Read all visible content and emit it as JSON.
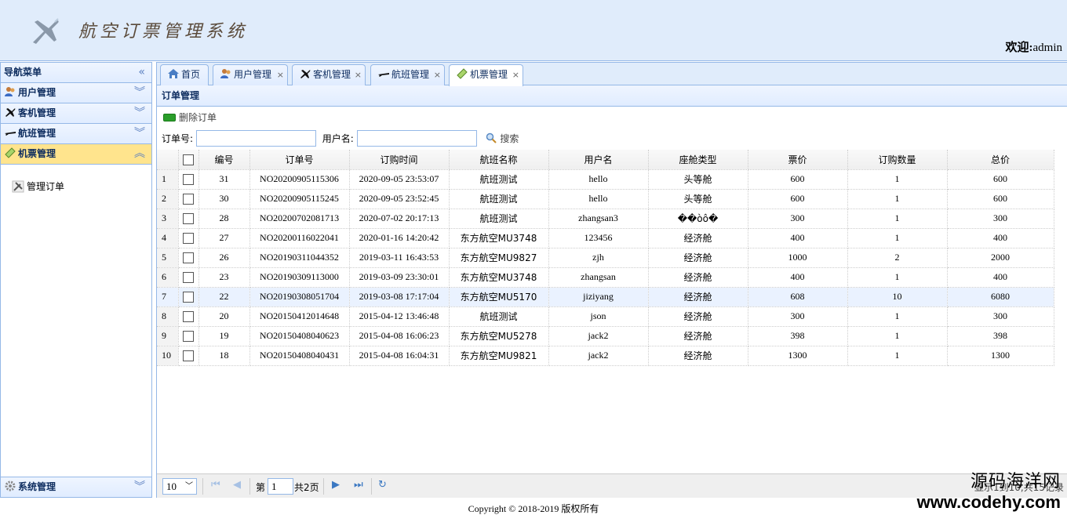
{
  "header": {
    "title": "航空订票管理系统",
    "welcome_label": "欢迎:",
    "username": "admin"
  },
  "nav": {
    "title": "导航菜单",
    "sections": [
      {
        "label": "用户管理",
        "icon": "users-icon"
      },
      {
        "label": "客机管理",
        "icon": "airplane-icon"
      },
      {
        "label": "航班管理",
        "icon": "flight-icon"
      },
      {
        "label": "机票管理",
        "icon": "ticket-icon"
      }
    ],
    "active_item": "管理订单",
    "bottom_section": "系统管理"
  },
  "tabs": [
    {
      "label": "首页",
      "icon": "home-icon",
      "closable": false
    },
    {
      "label": "用户管理",
      "icon": "users-icon",
      "closable": true
    },
    {
      "label": "客机管理",
      "icon": "airplane-icon",
      "closable": true
    },
    {
      "label": "航班管理",
      "icon": "flight-icon",
      "closable": true
    },
    {
      "label": "机票管理",
      "icon": "ticket-icon",
      "closable": true
    }
  ],
  "grid": {
    "title": "订单管理",
    "delete_label": "删除订单",
    "order_no_label": "订单号:",
    "username_label": "用户名:",
    "search_label": "搜索",
    "columns": [
      "编号",
      "订单号",
      "订购时间",
      "航班名称",
      "用户名",
      "座舱类型",
      "票价",
      "订购数量",
      "总价"
    ],
    "rows": [
      [
        "31",
        "NO20200905115306",
        "2020-09-05 23:53:07",
        "航班测试",
        "hello",
        "头等舱",
        "600",
        "1",
        "600"
      ],
      [
        "30",
        "NO20200905115245",
        "2020-09-05 23:52:45",
        "航班测试",
        "hello",
        "头等舱",
        "600",
        "1",
        "600"
      ],
      [
        "28",
        "NO20200702081713",
        "2020-07-02 20:17:13",
        "航班测试",
        "zhangsan3",
        "��òô�",
        "300",
        "1",
        "300"
      ],
      [
        "27",
        "NO20200116022041",
        "2020-01-16 14:20:42",
        "东方航空MU3748",
        "123456",
        "经济舱",
        "400",
        "1",
        "400"
      ],
      [
        "26",
        "NO20190311044352",
        "2019-03-11 16:43:53",
        "东方航空MU9827",
        "zjh",
        "经济舱",
        "1000",
        "2",
        "2000"
      ],
      [
        "23",
        "NO20190309113000",
        "2019-03-09 23:30:01",
        "东方航空MU3748",
        "zhangsan",
        "经济舱",
        "400",
        "1",
        "400"
      ],
      [
        "22",
        "NO20190308051704",
        "2019-03-08 17:17:04",
        "东方航空MU5170",
        "jiziyang",
        "经济舱",
        "608",
        "10",
        "6080"
      ],
      [
        "20",
        "NO20150412014648",
        "2015-04-12 13:46:48",
        "航班测试",
        "json",
        "经济舱",
        "300",
        "1",
        "300"
      ],
      [
        "19",
        "NO20150408040623",
        "2015-04-08 16:06:23",
        "东方航空MU5278",
        "jack2",
        "经济舱",
        "398",
        "1",
        "398"
      ],
      [
        "18",
        "NO20150408040431",
        "2015-04-08 16:04:31",
        "东方航空MU9821",
        "jack2",
        "经济舱",
        "1300",
        "1",
        "1300"
      ]
    ]
  },
  "pager": {
    "page_size": "10",
    "page_prefix": "第",
    "page_number": "1",
    "page_suffix": "共2页",
    "info": "显示1到10,共15记录"
  },
  "footer": "Copyright © 2018-2019 版权所有",
  "watermark": {
    "line1": "源码海洋网",
    "line2": "www.codehy.com"
  }
}
